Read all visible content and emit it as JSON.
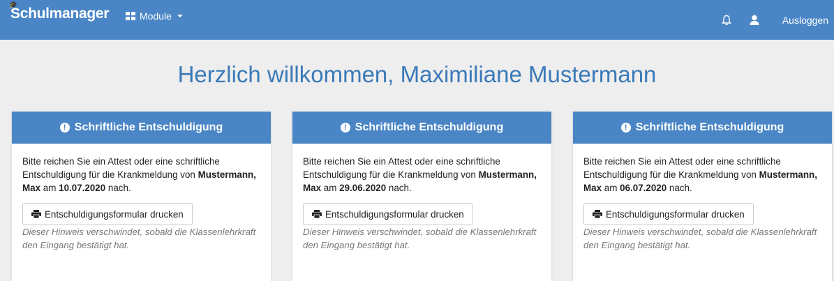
{
  "navbar": {
    "brand": "Schulmanager",
    "modules_label": "Module",
    "logout_label": "Ausloggen"
  },
  "welcome": "Herzlich willkommen, Maximiliane Mustermann",
  "cards": [
    {
      "title": "Schriftliche Entschuldigung",
      "text_before": "Bitte reichen Sie ein Attest oder eine schriftliche Entschuldigung für die Krankmeldung von",
      "student": "Mustermann, Max",
      "text_am": "am",
      "date": "10.07.2020",
      "text_after": "nach.",
      "button_label": "Entschuldigungsformular drucken",
      "hint": "Dieser Hinweis verschwindet, sobald die Klassenlehrkraft den Eingang bestätigt hat."
    },
    {
      "title": "Schriftliche Entschuldigung",
      "text_before": "Bitte reichen Sie ein Attest oder eine schriftliche Entschuldigung für die Krankmeldung von",
      "student": "Mustermann, Max",
      "text_am": "am",
      "date": "29.06.2020",
      "text_after": "nach.",
      "button_label": "Entschuldigungsformular drucken",
      "hint": "Dieser Hinweis verschwindet, sobald die Klassenlehrkraft den Eingang bestätigt hat."
    },
    {
      "title": "Schriftliche Entschuldigung",
      "text_before": "Bitte reichen Sie ein Attest oder eine schriftliche Entschuldigung für die Krankmeldung von",
      "student": "Mustermann, Max",
      "text_am": "am",
      "date": "06.07.2020",
      "text_after": "nach.",
      "button_label": "Entschuldigungsformular drucken",
      "hint": "Dieser Hinweis verschwindet, sobald die Klassenlehrkraft den Eingang bestätigt hat."
    }
  ],
  "colors": {
    "primary": "#4a86c6",
    "background": "#eeeeee",
    "heading": "#3a7ab8"
  },
  "icons": [
    "graduation-cap-icon",
    "grid-icon",
    "bell-icon",
    "user-icon",
    "exclamation-circle-icon",
    "print-icon"
  ]
}
